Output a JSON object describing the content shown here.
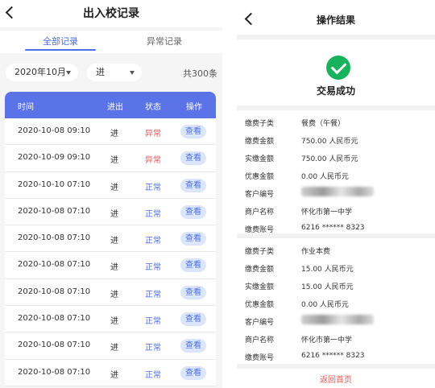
{
  "left": {
    "title": "出入校记录",
    "tabs": {
      "all": "全部记录",
      "abnormal": "异常记录"
    },
    "filters": {
      "month": "2020年10月",
      "direction": "进",
      "total": "共300条"
    },
    "columns": {
      "time": "时间",
      "direction": "进出",
      "status": "状态",
      "action": "操作"
    },
    "rows": [
      {
        "time": "2020-10-08 09:10",
        "direction": "进",
        "status": "异常",
        "action": "查看"
      },
      {
        "time": "2020-10-09 09:10",
        "direction": "进",
        "status": "异常",
        "action": "查看"
      },
      {
        "time": "2020-10-10 07:10",
        "direction": "进",
        "status": "正常",
        "action": "查看"
      },
      {
        "time": "2020-10-08 07:10",
        "direction": "进",
        "status": "正常",
        "action": "查看"
      },
      {
        "time": "2020-10-08 07:10",
        "direction": "进",
        "status": "正常",
        "action": "查看"
      },
      {
        "time": "2020-10-08 07:10",
        "direction": "进",
        "status": "正常",
        "action": "查看"
      },
      {
        "time": "2020-10-08 07:10",
        "direction": "进",
        "status": "正常",
        "action": "查看"
      },
      {
        "time": "2020-10-08 07:10",
        "direction": "进",
        "status": "正常",
        "action": "查看"
      },
      {
        "time": "2020-10-08 07:10",
        "direction": "进",
        "status": "正常",
        "action": "查看"
      },
      {
        "time": "2020-10-08 07:10",
        "direction": "进",
        "status": "正常",
        "action": "查看"
      }
    ]
  },
  "right": {
    "title": "操作结果",
    "result": "交易成功",
    "records": [
      {
        "fields": [
          {
            "k": "缴费子类",
            "v": "餐费（午餐）"
          },
          {
            "k": "缴费金额",
            "v": "750.00 人民币元"
          },
          {
            "k": "实缴金额",
            "v": "750.00 人民币元"
          },
          {
            "k": "优惠金额",
            "v": "0.00 人民币元"
          },
          {
            "k": "客户编号",
            "v": ""
          },
          {
            "k": "商户名称",
            "v": "怀化市第一中学"
          },
          {
            "k": "缴费账号",
            "v": "6216 ****** 8323"
          }
        ]
      },
      {
        "fields": [
          {
            "k": "缴费子类",
            "v": "作业本费"
          },
          {
            "k": "缴费金额",
            "v": "15.00 人民币元"
          },
          {
            "k": "实缴金额",
            "v": "15.00 人民币元"
          },
          {
            "k": "优惠金额",
            "v": "0.00 人民币元"
          },
          {
            "k": "客户编号",
            "v": ""
          },
          {
            "k": "商户名称",
            "v": "怀化市第一中学"
          },
          {
            "k": "缴费账号",
            "v": "6216 ****** 8323"
          }
        ]
      }
    ],
    "home_link": "返回首页"
  },
  "colors": {
    "accent": "#5a73e6",
    "link": "#4c6ee6",
    "abnormal": "#e05a5a",
    "success": "#17b35c",
    "view_bg": "#dbe6fb"
  },
  "icons": {
    "back": "chevron-left-icon",
    "success": "check-circle-icon",
    "dropdown": "caret-down-icon"
  }
}
